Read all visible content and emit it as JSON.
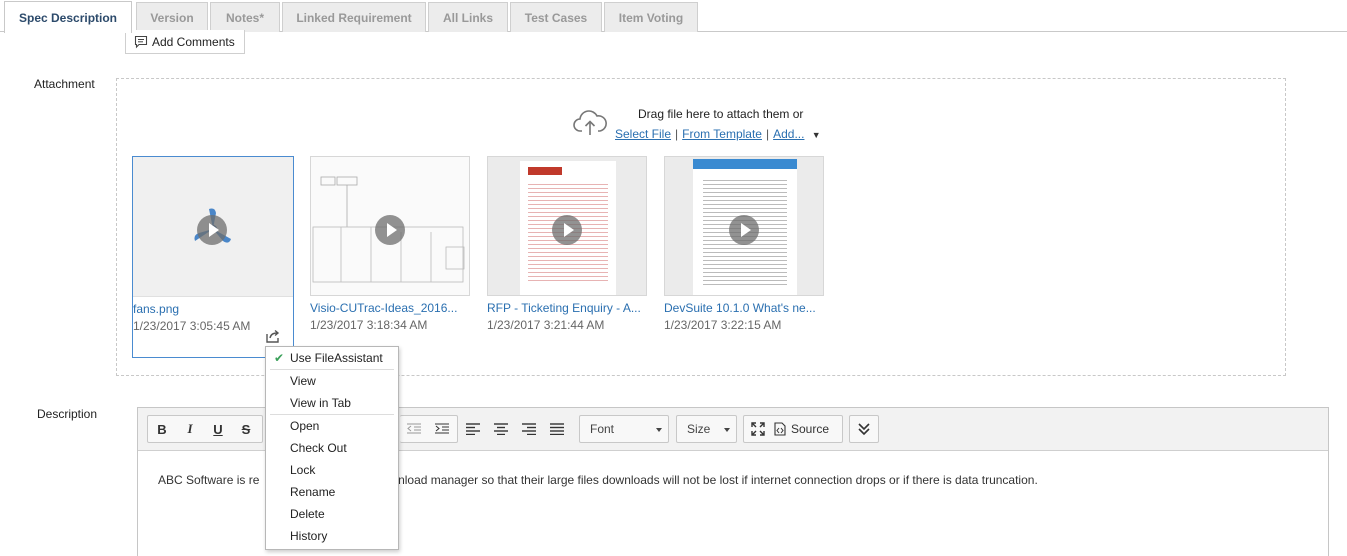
{
  "tabs": [
    {
      "label": "Spec Description",
      "active": true
    },
    {
      "label": "Version"
    },
    {
      "label": "Notes*"
    },
    {
      "label": "Linked Requirement"
    },
    {
      "label": "All Links"
    },
    {
      "label": "Test Cases"
    },
    {
      "label": "Item Voting"
    }
  ],
  "comments": {
    "button_label": "Add Comments"
  },
  "attachment": {
    "label": "Attachment",
    "drag_text": "Drag file here to attach them or",
    "select_file": "Select File",
    "from_template": "From Template",
    "add_more": "Add...",
    "separator": "|",
    "items": [
      {
        "name": "fans.png",
        "date": "1/23/2017 3:05:45 AM"
      },
      {
        "name": "Visio-CUTrac-Ideas_2016...",
        "date": "1/23/2017 3:18:34 AM"
      },
      {
        "name": "RFP - Ticketing Enquiry - A...",
        "date": "1/23/2017 3:21:44 AM"
      },
      {
        "name": "DevSuite 10.1.0 What's ne...",
        "date": "1/23/2017 3:22:15 AM"
      }
    ]
  },
  "context_menu": {
    "items": [
      "Use FileAssistant",
      "View",
      "View in Tab",
      "Open",
      "Check Out",
      "Lock",
      "Rename",
      "Delete",
      "History"
    ]
  },
  "description": {
    "label": "Description",
    "text": "ABC Software is re                              t a download manager so that their large files downloads will not be lost if internet connection drops or if there is data truncation."
  },
  "editor": {
    "bold": "B",
    "italic": "I",
    "underline": "U",
    "strike": "S",
    "font_label": "Font",
    "size_label": "Size",
    "source_label": "Source"
  },
  "colors": {
    "accent": "#2a6fb0",
    "tab_active_text": "#2c4a6b",
    "check": "#3aa05a"
  }
}
